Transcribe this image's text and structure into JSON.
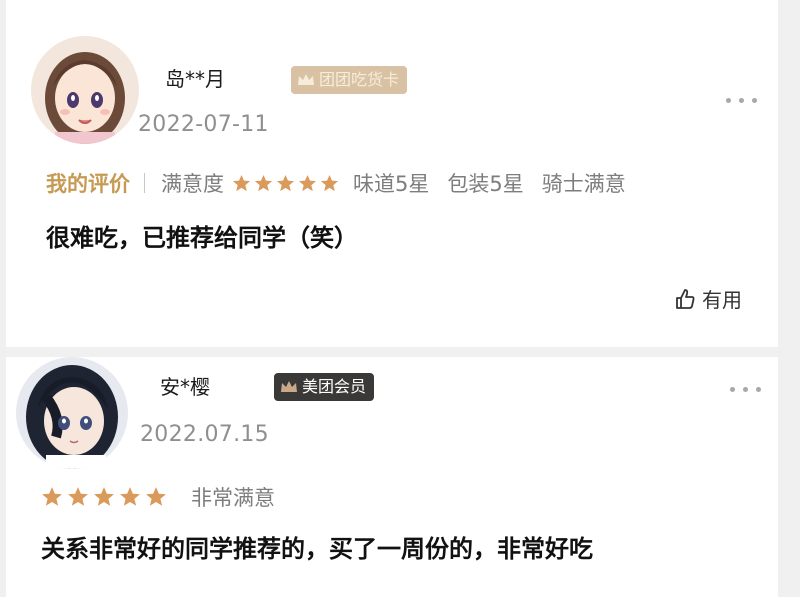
{
  "reviews": [
    {
      "username": "岛**月",
      "badge": "团团吃货卡",
      "date": "2022-07-11",
      "my_review_label": "我的评价",
      "satisfaction_label": "满意度",
      "stars": 5,
      "sub_ratings": [
        "味道5星",
        "包装5星",
        "骑士满意"
      ],
      "content": "很难吃，已推荐给同学（笑）",
      "useful_label": "有用"
    },
    {
      "username": "安*樱",
      "badge": "美团会员",
      "date": "2022.07.15",
      "stars": 5,
      "satisfaction_text": "非常满意",
      "content": "关系非常好的同学推荐的，买了一周份的，非常好吃"
    }
  ],
  "colors": {
    "star": "#d99a5b",
    "badge_gold": "#d8c2a3",
    "badge_dark": "#3b3937",
    "my_review": "#c69a54"
  },
  "icons": [
    "crown-icon",
    "star-icon",
    "more-icon",
    "thumbs-up-icon"
  ]
}
